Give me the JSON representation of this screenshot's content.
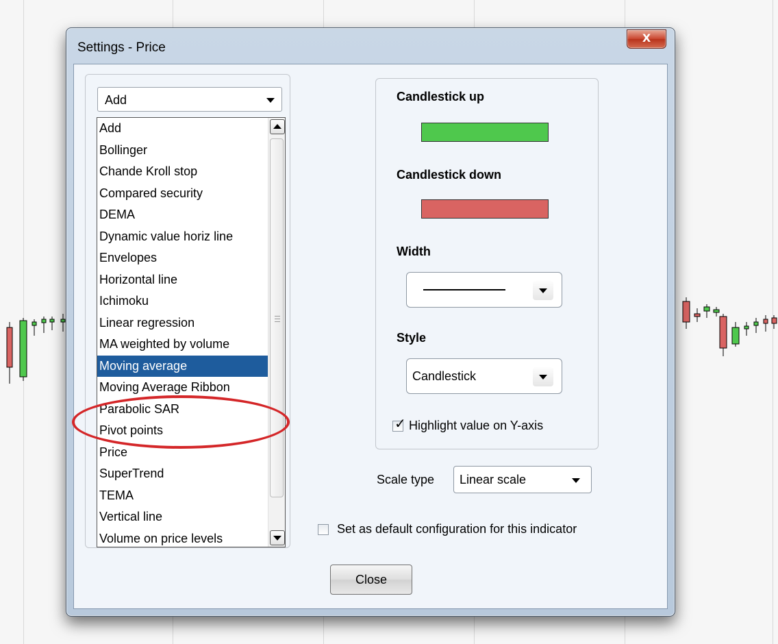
{
  "window": {
    "title": "Settings - Price",
    "close_glyph": "X"
  },
  "indicator_picker": {
    "selected": "Add",
    "items": [
      "Add",
      "Bollinger",
      "Chande Kroll stop",
      "Compared security",
      "DEMA",
      "Dynamic value horiz line",
      "Envelopes",
      "Horizontal line",
      "Ichimoku",
      "Linear regression",
      "MA weighted by volume",
      "Moving average",
      "Moving Average Ribbon",
      "Parabolic SAR",
      "Pivot points",
      "Price",
      "SuperTrend",
      "TEMA",
      "Vertical line",
      "Volume on price levels"
    ],
    "highlighted_item": "Moving average"
  },
  "appearance": {
    "up_label": "Candlestick up",
    "up_color": "#4fc84d",
    "down_label": "Candlestick down",
    "down_color": "#d96462",
    "width_label": "Width",
    "style_label": "Style",
    "style_value": "Candlestick",
    "highlight_label": "Highlight value on Y-axis",
    "highlight_checked": true
  },
  "scale": {
    "label": "Scale type",
    "value": "Linear scale"
  },
  "default_config": {
    "label": "Set as default configuration for this indicator",
    "checked": false
  },
  "buttons": {
    "close_label": "Close"
  },
  "colors": {
    "selection": "#1e5c9d",
    "annotation": "#d42628"
  }
}
